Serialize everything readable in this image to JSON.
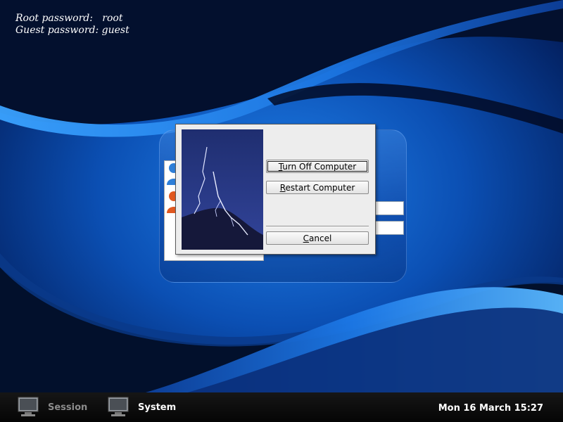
{
  "login_info": {
    "root_line": "Root password:   root",
    "guest_line": "Guest password: guest"
  },
  "shutdown_dialog": {
    "turn_off": {
      "mnemonic": "T",
      "rest": "urn Off Computer"
    },
    "restart": {
      "mnemonic": "R",
      "rest": "estart Computer"
    },
    "cancel": {
      "mnemonic": "C",
      "rest": "ancel"
    }
  },
  "taskbar": {
    "session_label": "Session",
    "system_label": "System",
    "clock": "Mon 16 March 15:27"
  },
  "colors": {
    "wallpaper_blue": "#1468d8",
    "dialog_bg": "#ededed",
    "session_label": "#8c8c8c",
    "system_label": "#ffffff"
  },
  "icons": {
    "session": "monitor-icon",
    "system": "monitor-icon",
    "users": "user-icon"
  }
}
